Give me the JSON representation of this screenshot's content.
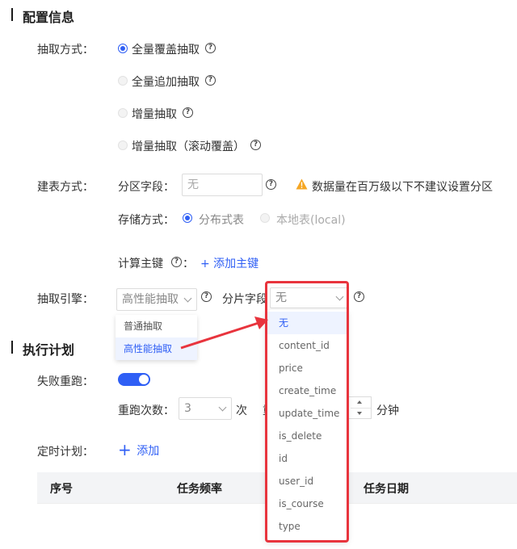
{
  "config": {
    "title": "配置信息",
    "extract_mode": {
      "label": "抽取方式：",
      "options": [
        "全量覆盖抽取",
        "全量追加抽取",
        "增量抽取",
        "增量抽取（滚动覆盖）"
      ]
    },
    "table_mode": {
      "label": "建表方式：",
      "partition_label": "分区字段：",
      "partition_placeholder": "无",
      "warning": "数据量在百万级以下不建议设置分区",
      "storage_label": "存储方式：",
      "storage_options": [
        "分布式表",
        "本地表(local)"
      ],
      "pk_label": "计算主键",
      "pk_colon": "：",
      "add_pk": "+ 添加主键"
    },
    "engine": {
      "label": "抽取引擎：",
      "selected": "高性能抽取",
      "options": [
        "普通抽取",
        "高性能抽取"
      ],
      "shard_label": "分片字段",
      "shard_selected": "无",
      "shard_options": [
        "无",
        "content_id",
        "price",
        "create_time",
        "update_time",
        "is_delete",
        "id",
        "user_id",
        "is_course",
        "type"
      ]
    }
  },
  "schedule": {
    "title": "执行计划",
    "retry_label": "失败重跑：",
    "retry_count_label": "重跑次数：",
    "retry_count": "3",
    "retry_unit": "次",
    "interval_prefix": "重",
    "interval_unit": "分钟",
    "timer_label": "定时计划：",
    "add_label": "添加",
    "table_headers": [
      "序号",
      "任务频率",
      "任务日期"
    ]
  },
  "colors": {
    "accent": "#2f5ff5",
    "highlight": "#e8343d",
    "warning": "#f5a623"
  }
}
